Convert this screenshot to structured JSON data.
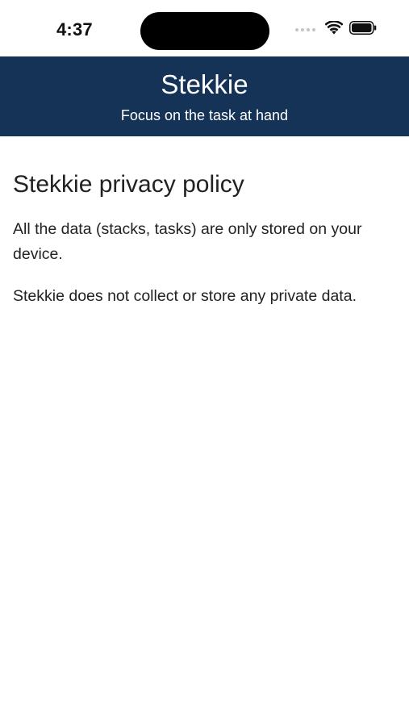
{
  "status_bar": {
    "time": "4:37",
    "icons": [
      "cellular-signal-icon",
      "wifi-icon",
      "battery-icon"
    ]
  },
  "header": {
    "title": "Stekkie",
    "subtitle": "Focus on the task at hand",
    "background_color": "#143356"
  },
  "main": {
    "heading": "Stekkie privacy policy",
    "paragraphs": [
      "All the data (stacks, tasks) are only stored on your device.",
      "Stekkie does not collect or store any private data."
    ]
  }
}
